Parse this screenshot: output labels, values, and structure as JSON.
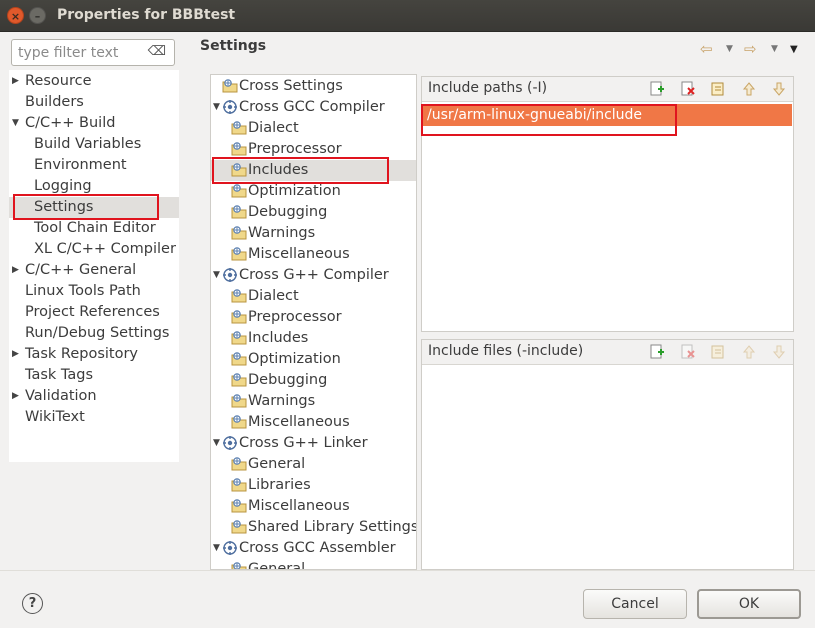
{
  "window": {
    "title": "Properties for BBBtest",
    "close_glyph": "×",
    "minimize_glyph": "–"
  },
  "filter": {
    "placeholder": "type filter text",
    "value": "",
    "clear_glyph": "⌫"
  },
  "nav": {
    "items": [
      {
        "label": "Resource",
        "expandable": true
      },
      {
        "label": "Builders",
        "expandable": false
      },
      {
        "label": "C/C++ Build",
        "expandable": true,
        "expanded": true
      },
      {
        "label": "Build Variables",
        "child": true
      },
      {
        "label": "Environment",
        "child": true
      },
      {
        "label": "Logging",
        "child": true
      },
      {
        "label": "Settings",
        "child": true,
        "selected": true
      },
      {
        "label": "Tool Chain Editor",
        "child": true
      },
      {
        "label": "XL C/C++ Compiler",
        "child": true
      },
      {
        "label": "C/C++ General",
        "expandable": true
      },
      {
        "label": "Linux Tools Path",
        "expandable": false
      },
      {
        "label": "Project References",
        "expandable": false
      },
      {
        "label": "Run/Debug Settings",
        "expandable": false
      },
      {
        "label": "Task Repository",
        "expandable": true
      },
      {
        "label": "Task Tags",
        "expandable": false
      },
      {
        "label": "Validation",
        "expandable": true
      },
      {
        "label": "WikiText",
        "expandable": false
      }
    ]
  },
  "header": {
    "title": "Settings",
    "back_icon": "back-arrow-icon",
    "forward_icon": "forward-arrow-icon"
  },
  "tool_tree": {
    "items": [
      {
        "label": "Cross Settings",
        "level": 0
      },
      {
        "label": "Cross GCC Compiler",
        "level": 0,
        "group": true
      },
      {
        "label": "Dialect",
        "level": 1
      },
      {
        "label": "Preprocessor",
        "level": 1
      },
      {
        "label": "Includes",
        "level": 1,
        "selected": true
      },
      {
        "label": "Optimization",
        "level": 1
      },
      {
        "label": "Debugging",
        "level": 1
      },
      {
        "label": "Warnings",
        "level": 1
      },
      {
        "label": "Miscellaneous",
        "level": 1
      },
      {
        "label": "Cross G++ Compiler",
        "level": 0,
        "group": true
      },
      {
        "label": "Dialect",
        "level": 1
      },
      {
        "label": "Preprocessor",
        "level": 1
      },
      {
        "label": "Includes",
        "level": 1
      },
      {
        "label": "Optimization",
        "level": 1
      },
      {
        "label": "Debugging",
        "level": 1
      },
      {
        "label": "Warnings",
        "level": 1
      },
      {
        "label": "Miscellaneous",
        "level": 1
      },
      {
        "label": "Cross G++ Linker",
        "level": 0,
        "group": true
      },
      {
        "label": "General",
        "level": 1
      },
      {
        "label": "Libraries",
        "level": 1
      },
      {
        "label": "Miscellaneous",
        "level": 1
      },
      {
        "label": "Shared Library Settings",
        "level": 1
      },
      {
        "label": "Cross GCC Assembler",
        "level": 0,
        "group": true
      },
      {
        "label": "General",
        "level": 1
      }
    ]
  },
  "include_paths": {
    "title": "Include paths (-I)",
    "entries": [
      "/usr/arm-linux-gnueabi/include"
    ]
  },
  "include_files": {
    "title": "Include files (-include)",
    "entries": []
  },
  "buttons": {
    "help": "?",
    "cancel": "Cancel",
    "ok": "OK"
  },
  "colors": {
    "selection": "#f07746",
    "highlight_box": "#e0141e",
    "titlebar": "#3f3e3a"
  }
}
